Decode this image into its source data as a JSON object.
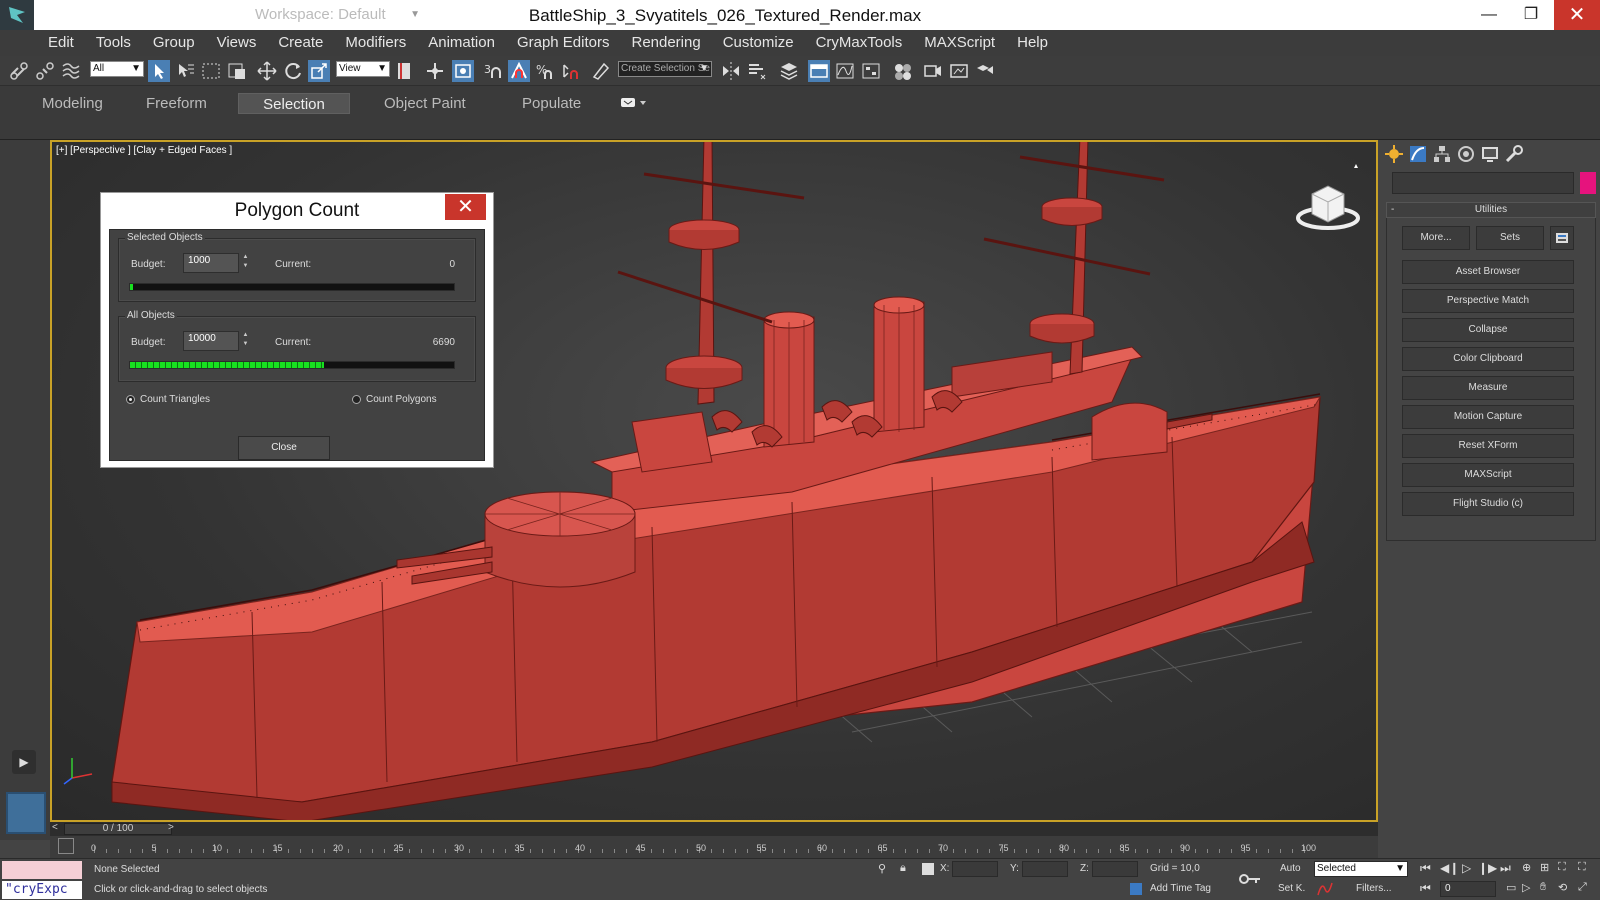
{
  "titlebar": {
    "workspace": "Workspace: Default",
    "title": "BattleShip_3_Svyatitels_026_Textured_Render.max",
    "minimize": "—",
    "restore": "❐",
    "close": "✕"
  },
  "menu": [
    "Edit",
    "Tools",
    "Group",
    "Views",
    "Create",
    "Modifiers",
    "Animation",
    "Graph Editors",
    "Rendering",
    "Customize",
    "CryMaxTools",
    "MAXScript",
    "Help"
  ],
  "toolbar": {
    "selection_filter": "All",
    "ref_coord": "View",
    "named_selection": "Create Selection Se"
  },
  "ribbon": {
    "tabs": [
      "Modeling",
      "Freeform",
      "Selection",
      "Object Paint",
      "Populate"
    ],
    "active": "Selection"
  },
  "viewport": {
    "label": "[+] [Perspective ] [Clay + Edged Faces ]"
  },
  "dialog": {
    "title": "Polygon Count",
    "close_x": "✕",
    "selected": {
      "label": "Selected Objects",
      "budget_label": "Budget:",
      "budget": "1000",
      "current_label": "Current:",
      "current": "0",
      "progress": 0.01
    },
    "all": {
      "label": "All Objects",
      "budget_label": "Budget:",
      "budget": "10000",
      "current_label": "Current:",
      "current": "6690",
      "progress": 0.6
    },
    "count_triangles": "Count Triangles",
    "count_polygons": "Count Polygons",
    "close_button": "Close"
  },
  "command_panel": {
    "rollout_title": "Utilities",
    "rollout_toggle": "-",
    "more_button": "More...",
    "sets_button": "Sets",
    "utilities": [
      "Asset Browser",
      "Perspective Match",
      "Collapse",
      "Color Clipboard",
      "Measure",
      "Motion Capture",
      "Reset XForm",
      "MAXScript",
      "Flight Studio (c)"
    ]
  },
  "timeline": {
    "frame": "0 / 100",
    "labels": [
      "0",
      "5",
      "10",
      "15",
      "20",
      "25",
      "30",
      "35",
      "40",
      "45",
      "50",
      "55",
      "60",
      "65",
      "70",
      "75",
      "80",
      "85",
      "90",
      "95",
      "100"
    ]
  },
  "statusbar": {
    "maxscript_listener": "\"cryExpc",
    "selection_status": "None Selected",
    "prompt": "Click or click-and-drag to select objects",
    "x_label": "X:",
    "y_label": "Y:",
    "z_label": "Z:",
    "grid": "Grid = 10,0",
    "add_time_tag": "Add Time Tag",
    "auto": "Auto",
    "set_key": "Set K.",
    "key_filter": "Selected",
    "filters": "Filters...",
    "current_frame": "0"
  }
}
